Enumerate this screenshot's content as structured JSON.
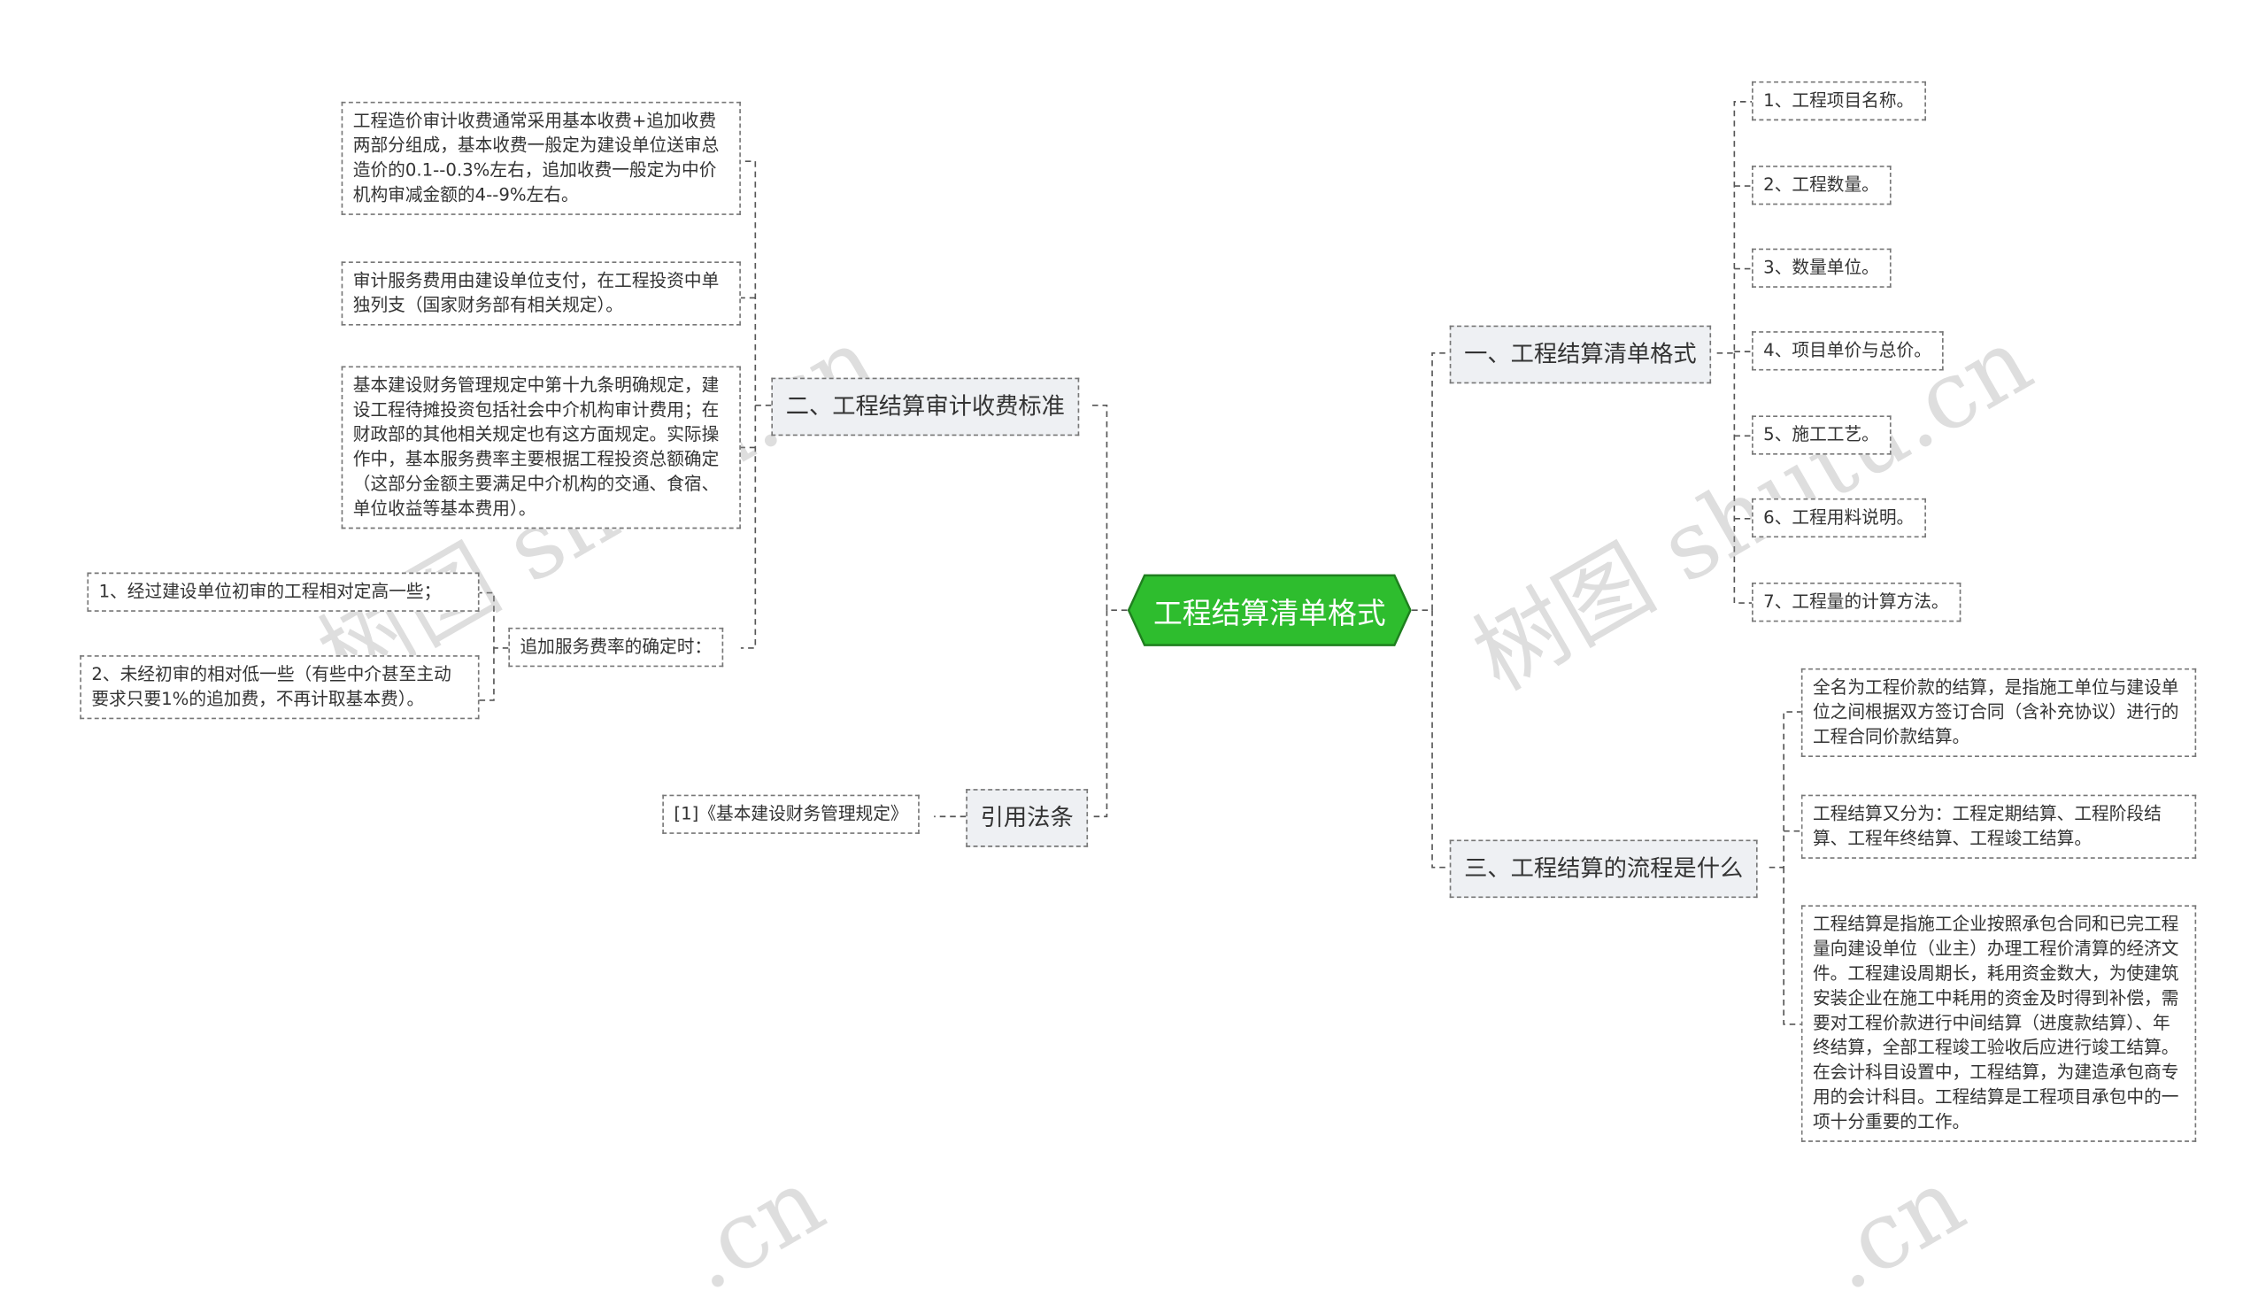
{
  "center": {
    "label": "工程结算清单格式",
    "color": "#2ebd2e"
  },
  "branches": {
    "b1": {
      "label": "一、工程结算清单格式",
      "items": [
        "1、工程项目名称。",
        "2、工程数量。",
        "3、数量单位。",
        "4、项目单价与总价。",
        "5、施工工艺。",
        "6、工程用料说明。",
        "7、工程量的计算方法。"
      ]
    },
    "b2": {
      "label": "二、工程结算审计收费标准",
      "items": [
        "工程造价审计收费通常采用基本收费+追加收费两部分组成，基本收费一般定为建设单位送审总造价的0.1--0.3%左右，追加收费一般定为中价机构审减金额的4--9%左右。",
        "审计服务费用由建设单位支付，在工程投资中单独列支（国家财务部有相关规定）。",
        "基本建设财务管理规定中第十九条明确规定，建设工程待摊投资包括社会中介机构审计费用；在财政部的其他相关规定也有这方面规定。实际操作中，基本服务费率主要根据工程投资总额确定（这部分金额主要满足中介机构的交通、食宿、单位收益等基本费用）。",
        "追加服务费率的确定时："
      ],
      "sub_items": [
        "1、经过建设单位初审的工程相对定高一些；",
        "2、未经初审的相对低一些（有些中介甚至主动要求只要1%的追加费，不再计取基本费）。"
      ]
    },
    "b3": {
      "label": "三、工程结算的流程是什么",
      "items": [
        "全名为工程价款的结算，是指施工单位与建设单位之间根据双方签订合同（含补充协议）进行的工程合同价款结算。",
        "工程结算又分为：工程定期结算、工程阶段结算、工程年终结算、工程竣工结算。",
        "工程结算是指施工企业按照承包合同和已完工程量向建设单位（业主）办理工程价清算的经济文件。工程建设周期长，耗用资金数大，为使建筑安装企业在施工中耗用的资金及时得到补偿，需要对工程价款进行中间结算（进度款结算）、年终结算，全部工程竣工验收后应进行竣工结算。在会计科目设置中，工程结算，为建造承包商专用的会计科目。工程结算是工程项目承包中的一项十分重要的工作。"
      ]
    },
    "b4": {
      "label": "引用法条",
      "items": [
        "[1]《基本建设财务管理规定》"
      ]
    }
  },
  "watermarks": [
    "树图 shutu.cn",
    "树图 shutu.cn",
    ".cn",
    ".cn"
  ]
}
